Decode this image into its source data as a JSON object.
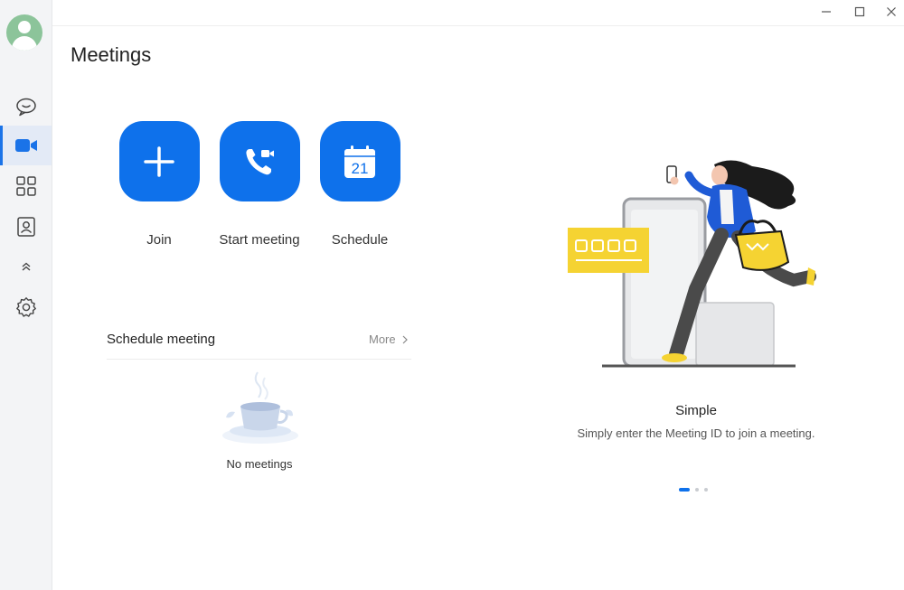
{
  "window": {
    "controls": [
      "minimize-icon",
      "maximize-icon",
      "close-icon"
    ]
  },
  "sidebar": {
    "items": [
      {
        "name": "chat",
        "icon": "chat-bubble-icon"
      },
      {
        "name": "meetings",
        "icon": "video-camera-icon",
        "active": true
      },
      {
        "name": "apps",
        "icon": "grid-icon"
      },
      {
        "name": "contacts",
        "icon": "contacts-icon"
      },
      {
        "name": "collapse",
        "icon": "double-chevron-up-icon"
      },
      {
        "name": "settings",
        "icon": "gear-icon"
      }
    ]
  },
  "header": {
    "title": "Meetings"
  },
  "actions": {
    "join_label": "Join",
    "start_label": "Start meeting",
    "schedule_label": "Schedule",
    "calendar_day": "21"
  },
  "schedule": {
    "title": "Schedule meeting",
    "more_label": "More",
    "empty_text": "No meetings"
  },
  "feature": {
    "title": "Simple",
    "description": "Simply enter the Meeting ID to join a meeting.",
    "carousel_active_index": 0,
    "carousel_count": 3
  },
  "colors": {
    "accent": "#0e71eb",
    "sidebar_bg": "#f3f4f6",
    "yellow": "#f5d332"
  }
}
